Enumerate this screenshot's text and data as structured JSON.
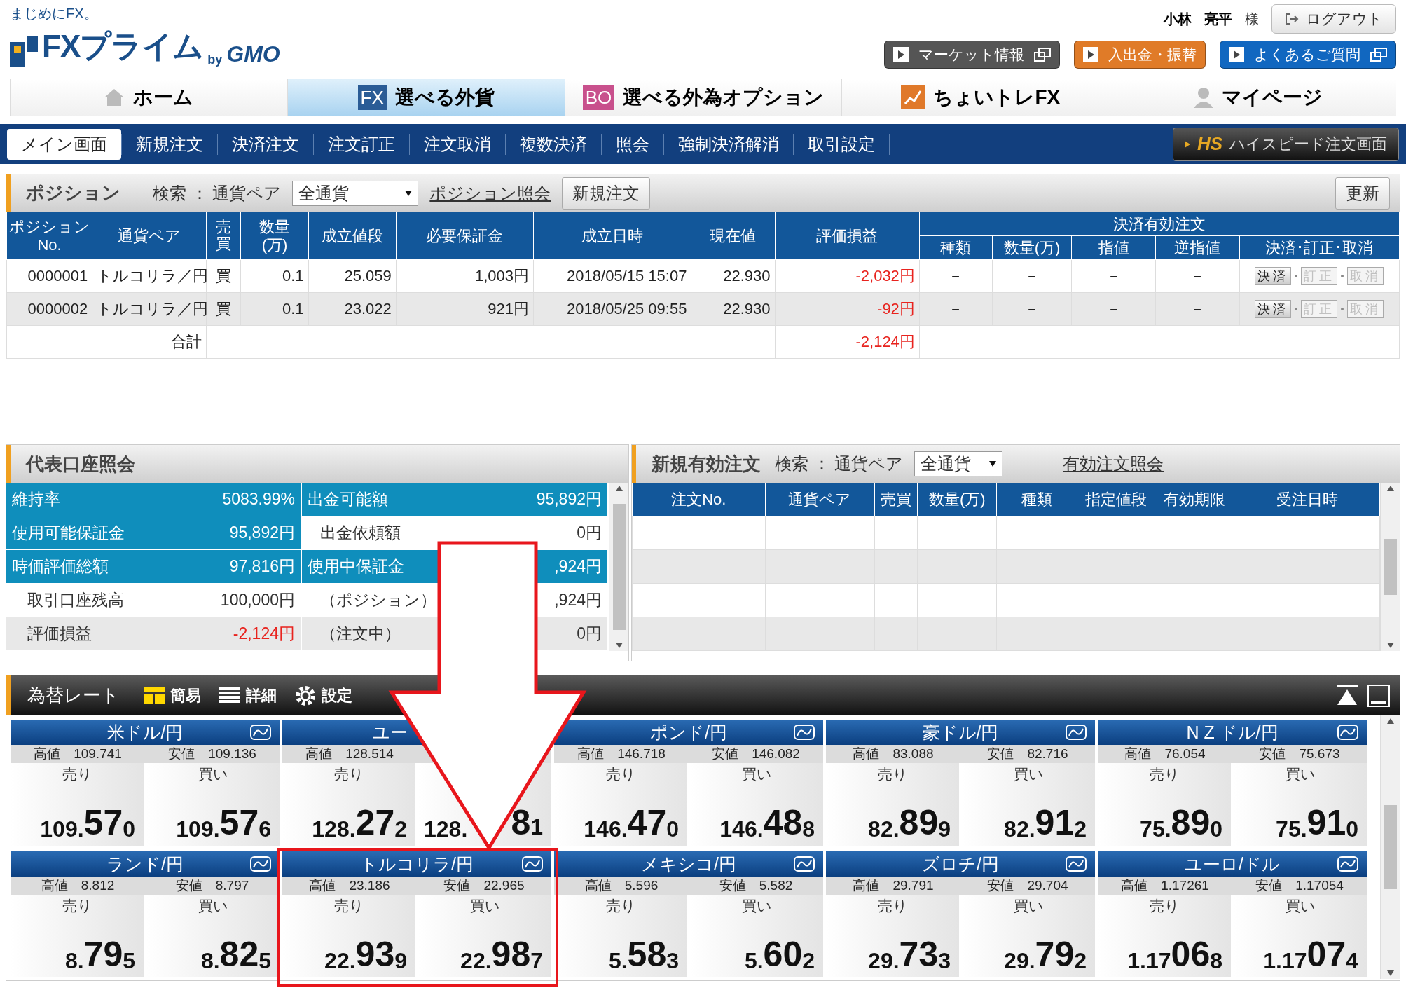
{
  "header": {
    "tagline": "まじめにFX。",
    "logo": {
      "main": "FXプライム",
      "by": "by",
      "brand": "GMO"
    },
    "user": {
      "surname": "小林",
      "given": "亮平",
      "honorific": "様"
    },
    "logout": "ログアウト",
    "buttons": [
      {
        "label": "マーケット情報",
        "external": true,
        "color": "#555555"
      },
      {
        "label": "入出金・振替",
        "external": false,
        "color": "#e07b28"
      },
      {
        "label": "よくあるご質問",
        "external": true,
        "color": "#1167c0"
      }
    ]
  },
  "nav_tabs": [
    {
      "label": "ホーム",
      "kind": "home",
      "selected": false
    },
    {
      "label": "選べる外貨",
      "kind": "badge",
      "badge": "FX",
      "color": "#2a5c96",
      "selected": true
    },
    {
      "label": "選べる外為オプション",
      "kind": "badge",
      "badge": "BO",
      "color": "#c8508c",
      "selected": false
    },
    {
      "label": "ちょいトレFX",
      "kind": "systrade",
      "selected": false
    },
    {
      "label": "マイページ",
      "kind": "person",
      "selected": false
    }
  ],
  "sub_nav": {
    "items": [
      {
        "label": "メイン画面",
        "selected": true
      },
      {
        "label": "新規注文",
        "selected": false
      },
      {
        "label": "決済注文",
        "selected": false
      },
      {
        "label": "注文訂正",
        "selected": false
      },
      {
        "label": "注文取消",
        "selected": false
      },
      {
        "label": "複数決済",
        "selected": false
      },
      {
        "label": "照会",
        "selected": false
      },
      {
        "label": "強制決済解消",
        "selected": false
      },
      {
        "label": "取引設定",
        "selected": false
      }
    ],
    "speed_button": {
      "mark": "HS",
      "label": "ハイスピード注文画面"
    }
  },
  "positions": {
    "title": "ポジション",
    "search_label": "検索 ： 通貨ペア",
    "filter": "全通貨",
    "link": "ポジション照会",
    "new_order": "新規注文",
    "refresh": "更新",
    "columns": [
      "ポジション\nNo.",
      "通貨ペア",
      "売買",
      "数量\n(万)",
      "成立値段",
      "必要保証金",
      "成立日時",
      "現在値",
      "評価損益"
    ],
    "group_header": "決済有効注文",
    "sub_columns": [
      "種類",
      "数量(万)",
      "指値",
      "逆指値",
      "決済･訂正･取消"
    ],
    "rows": [
      {
        "no": "0000001",
        "pair": "トルコリラ／円",
        "side": "買",
        "qty": "0.1",
        "price": "25.059",
        "margin": "1,003円",
        "date": "2018/05/15 15:07",
        "current": "22.930",
        "pl": "-2,032円",
        "orders": [
          "－",
          "－",
          "－",
          "－"
        ],
        "actions": [
          {
            "label": "決済",
            "disabled": false
          },
          {
            "label": "訂正",
            "disabled": true
          },
          {
            "label": "取消",
            "disabled": true
          }
        ]
      },
      {
        "no": "0000002",
        "pair": "トルコリラ／円",
        "side": "買",
        "qty": "0.1",
        "price": "23.022",
        "margin": "921円",
        "date": "2018/05/25 09:55",
        "current": "22.930",
        "pl": "-92円",
        "orders": [
          "－",
          "－",
          "－",
          "－"
        ],
        "actions": [
          {
            "label": "決済",
            "disabled": false
          },
          {
            "label": "訂正",
            "disabled": true
          },
          {
            "label": "取消",
            "disabled": true
          }
        ]
      }
    ],
    "total": {
      "label": "合計",
      "pl": "-2,124円"
    }
  },
  "account": {
    "title": "代表口座照会",
    "left": [
      {
        "label": "維持率",
        "value": "5083.99%",
        "highlight": true,
        "negative": false
      },
      {
        "label": "使用可能保証金",
        "value": "95,892円",
        "highlight": true,
        "negative": false
      },
      {
        "label": "時価評価総額",
        "value": "97,816円",
        "highlight": true,
        "negative": false
      },
      {
        "label": "取引口座残高",
        "value": "100,000円",
        "highlight": false,
        "negative": false
      },
      {
        "label": "評価損益",
        "value": "-2,124円",
        "highlight": false,
        "negative": true
      }
    ],
    "right": [
      {
        "label": "出金可能額",
        "value": "95,892円",
        "highlight": true,
        "negative": false
      },
      {
        "label": "出金依頼額",
        "value": "0円",
        "highlight": false,
        "negative": false
      },
      {
        "label": "使用中保証金",
        "value": ",924円",
        "highlight": true,
        "negative": false
      },
      {
        "label": "（ポジション）",
        "value": ",924円",
        "highlight": false,
        "negative": false
      },
      {
        "label": "（注文中）",
        "value": "0円",
        "highlight": false,
        "negative": false
      }
    ]
  },
  "orders": {
    "title": "新規有効注文",
    "search_label": "検索 ： 通貨ペア",
    "filter": "全通貨",
    "link": "有効注文照会",
    "columns": [
      "注文No.",
      "通貨ペア",
      "売買",
      "数量(万)",
      "種類",
      "指定値段",
      "有効期限",
      "受注日時"
    ]
  },
  "rates": {
    "title": "為替レート",
    "views": [
      {
        "label": "簡易",
        "kind": "simple",
        "selected": true
      },
      {
        "label": "詳細",
        "kind": "detail",
        "selected": false
      }
    ],
    "settings": "設定",
    "tiles": [
      {
        "pair": "米ドル/円",
        "high_label": "高値",
        "high": "109.741",
        "low_label": "安値",
        "low": "109.136",
        "sell_label": "売り",
        "buy_label": "買い",
        "bid": [
          "109.",
          "57",
          "0"
        ],
        "ask": [
          "109.",
          "57",
          "6"
        ]
      },
      {
        "pair": "ユー",
        "cut": true,
        "high_label": "高値",
        "high": "128.514",
        "sell_label": "売り",
        "bid": [
          "128.",
          "27",
          "2"
        ],
        "ask": [
          "128.",
          "8",
          "1"
        ]
      },
      {
        "pair": "ポンド/円",
        "high_label": "高値",
        "high": "146.718",
        "low_label": "安値",
        "low": "146.082",
        "sell_label": "売り",
        "buy_label": "買い",
        "bid": [
          "146.",
          "47",
          "0"
        ],
        "ask": [
          "146.",
          "48",
          "8"
        ]
      },
      {
        "pair": "豪ドル/円",
        "high_label": "高値",
        "high": "83.088",
        "low_label": "安値",
        "low": "82.716",
        "sell_label": "売り",
        "buy_label": "買い",
        "bid": [
          "82.",
          "89",
          "9"
        ],
        "ask": [
          "82.",
          "91",
          "2"
        ]
      },
      {
        "pair": "N Z ドル/円",
        "high_label": "高値",
        "high": "76.054",
        "low_label": "安値",
        "low": "75.673",
        "sell_label": "売り",
        "buy_label": "買い",
        "bid": [
          "75.",
          "89",
          "0"
        ],
        "ask": [
          "75.",
          "91",
          "0"
        ]
      },
      {
        "pair": "ランド/円",
        "high_label": "高値",
        "high": "8.812",
        "low_label": "安値",
        "low": "8.797",
        "sell_label": "売り",
        "buy_label": "買い",
        "bid": [
          "8.",
          "79",
          "5"
        ],
        "ask": [
          "8.",
          "82",
          "5"
        ]
      },
      {
        "pair": "トルコリラ/円",
        "high_label": "高値",
        "high": "23.186",
        "low_label": "安値",
        "low": "22.965",
        "sell_label": "売り",
        "buy_label": "買い",
        "bid": [
          "22.",
          "93",
          "9"
        ],
        "ask": [
          "22.",
          "98",
          "7"
        ]
      },
      {
        "pair": "メキシコ/円",
        "high_label": "高値",
        "high": "5.596",
        "low_label": "安値",
        "low": "5.582",
        "sell_label": "売り",
        "buy_label": "買い",
        "bid": [
          "5.",
          "58",
          "3"
        ],
        "ask": [
          "5.",
          "60",
          "2"
        ]
      },
      {
        "pair": "ズロチ/円",
        "high_label": "高値",
        "high": "29.791",
        "low_label": "安値",
        "low": "29.704",
        "sell_label": "売り",
        "buy_label": "買い",
        "bid": [
          "29.",
          "73",
          "3"
        ],
        "ask": [
          "29.",
          "79",
          "2"
        ]
      },
      {
        "pair": "ユーロ/ドル",
        "high_label": "高値",
        "high": "1.17261",
        "low_label": "安値",
        "low": "1.17054",
        "sell_label": "売り",
        "buy_label": "買い",
        "bid": [
          "1.17",
          "06",
          "8"
        ],
        "ask": [
          "1.17",
          "07",
          "4"
        ]
      }
    ]
  }
}
